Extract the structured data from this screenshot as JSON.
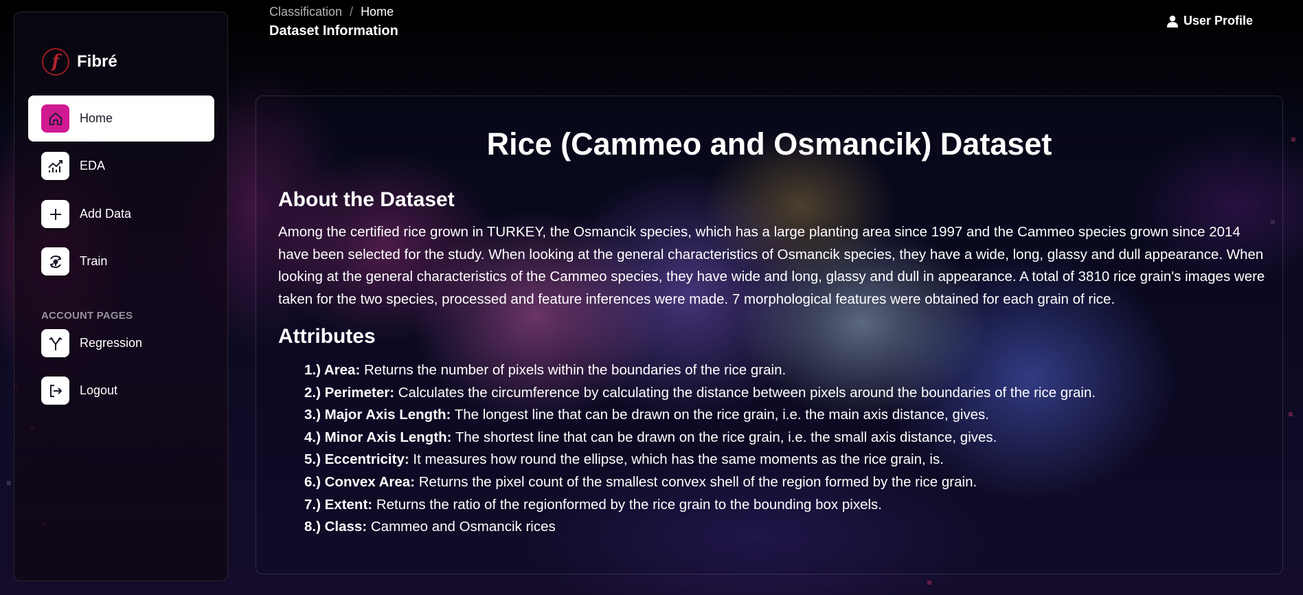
{
  "brand": {
    "name": "Fibré",
    "logo_letter": "f"
  },
  "sidebar": {
    "items": [
      {
        "label": "Home",
        "icon": "home-icon",
        "active": true
      },
      {
        "label": "EDA",
        "icon": "chart-icon",
        "active": false
      },
      {
        "label": "Add Data",
        "icon": "plus-icon",
        "active": false
      },
      {
        "label": "Train",
        "icon": "train-icon",
        "active": false
      }
    ],
    "section_heading": "ACCOUNT PAGES",
    "account_items": [
      {
        "label": "Regression",
        "icon": "split-arrows-icon"
      },
      {
        "label": "Logout",
        "icon": "logout-icon"
      }
    ]
  },
  "header": {
    "breadcrumb_parent": "Classification",
    "breadcrumb_separator": "/",
    "breadcrumb_current": "Home",
    "page_title": "Dataset Information",
    "user_profile": "User Profile"
  },
  "main": {
    "title": "Rice (Cammeo and Osmancik) Dataset",
    "about_heading": "About the Dataset",
    "about_text": "Among the certified rice grown in TURKEY, the Osmancik species, which has a large planting area since 1997 and the Cammeo species grown since 2014 have been selected for the study. When looking at the general characteristics of Osmancik species, they have a wide, long, glassy and dull appearance. When looking at the general characteristics of the Cammeo species, they have wide and long, glassy and dull in appearance. A total of 3810 rice grain's images were taken for the two species, processed and feature inferences were made. 7 morphological features were obtained for each grain of rice.",
    "attributes_heading": "Attributes",
    "attributes": [
      {
        "name": "1.) Area:",
        "desc": "Returns the number of pixels within the boundaries of the rice grain."
      },
      {
        "name": "2.) Perimeter:",
        "desc": "Calculates the circumference by calculating the distance between pixels around the boundaries of the rice grain."
      },
      {
        "name": "3.) Major Axis Length:",
        "desc": "The longest line that can be drawn on the rice grain, i.e. the main axis distance, gives."
      },
      {
        "name": "4.) Minor Axis Length:",
        "desc": "The shortest line that can be drawn on the rice grain, i.e. the small axis distance, gives."
      },
      {
        "name": "5.) Eccentricity:",
        "desc": "It measures how round the ellipse, which has the same moments as the rice grain, is."
      },
      {
        "name": "6.) Convex Area:",
        "desc": "Returns the pixel count of the smallest convex shell of the region formed by the rice grain."
      },
      {
        "name": "7.) Extent:",
        "desc": "Returns the ratio of the regionformed by the rice grain to the bounding box pixels."
      },
      {
        "name": "8.) Class:",
        "desc": "Cammeo and Osmancik rices"
      }
    ]
  },
  "colors": {
    "accent": "#d01a92",
    "logo_red": "#b3232a"
  }
}
